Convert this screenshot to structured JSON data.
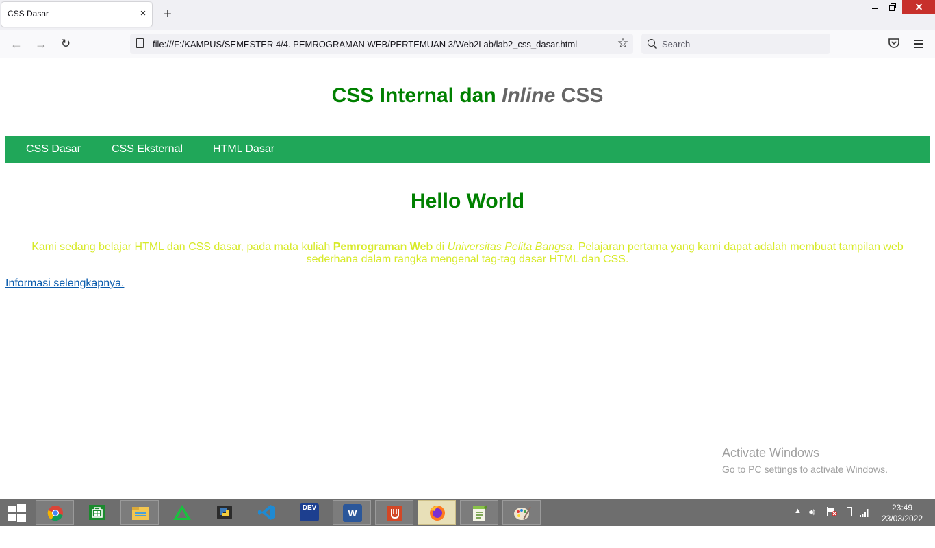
{
  "browser": {
    "tab_title": "CSS Dasar",
    "tab_close": "×",
    "new_tab": "+",
    "url": "file:///F:/KAMPUS/SEMESTER 4/4. PEMROGRAMAN WEB/PERTEMUAN 3/Web2Lab/lab2_css_dasar.html",
    "search_placeholder": "Search",
    "back_glyph": "←",
    "forward_glyph": "→",
    "reload_glyph": "↻",
    "star_glyph": "☆"
  },
  "page": {
    "heading_main": "CSS Internal dan ",
    "heading_italic": "Inline",
    "heading_tail": " CSS",
    "menu": [
      {
        "label": "CSS Dasar"
      },
      {
        "label": "CSS Eksternal"
      },
      {
        "label": "HTML Dasar"
      }
    ],
    "hello": "Hello World",
    "para_part1": "Kami sedang belajar HTML dan CSS dasar, pada mata kuliah ",
    "para_bold": "Pemrograman Web",
    "para_part2": " di ",
    "para_italic": "Universitas Pelita Bangsa",
    "para_part3": ". Pelajaran pertama yang kami dapat adalah membuat tampilan web sederhana dalam rangka mengenal tag-tag dasar HTML dan CSS.",
    "more_link": "Informasi selengkapnya.",
    "colors": {
      "heading": "#008000",
      "heading_accent": "#666666",
      "menu_bg": "#20a759",
      "paragraph": "#d7ea29",
      "link": "#0b5cad"
    }
  },
  "watermark": {
    "title": "Activate Windows",
    "subtitle": "Go to PC settings to activate Windows."
  },
  "taskbar": {
    "apps": [
      {
        "name": "chrome-icon"
      },
      {
        "name": "store-icon"
      },
      {
        "name": "file-explorer-icon"
      },
      {
        "name": "sublime-green-icon"
      },
      {
        "name": "python-icon"
      },
      {
        "name": "vscode-icon"
      },
      {
        "name": "devcpp-icon",
        "label": "DEV"
      },
      {
        "name": "word-icon",
        "label": "W"
      },
      {
        "name": "acrobat-icon"
      },
      {
        "name": "firefox-icon"
      },
      {
        "name": "notepadpp-icon"
      },
      {
        "name": "paint-icon"
      }
    ],
    "time": "23:49",
    "date": "23/03/2022"
  }
}
